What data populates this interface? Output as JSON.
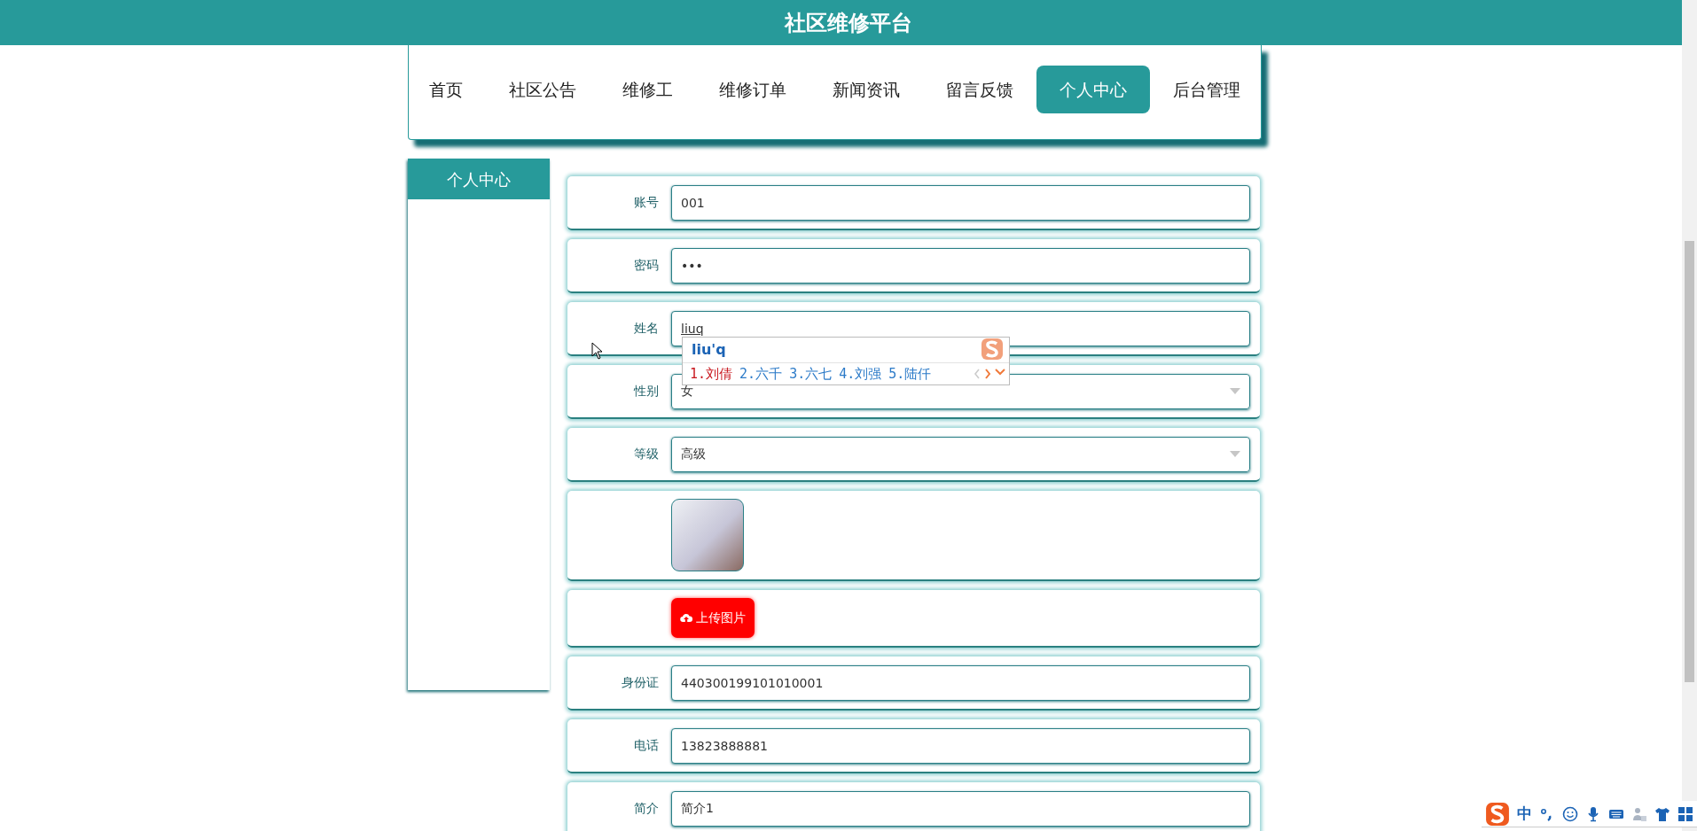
{
  "header": {
    "title": "社区维修平台"
  },
  "nav": [
    {
      "label": "首页",
      "selected": false
    },
    {
      "label": "社区公告",
      "selected": false
    },
    {
      "label": "维修工",
      "selected": false
    },
    {
      "label": "维修订单",
      "selected": false
    },
    {
      "label": "新闻资讯",
      "selected": false
    },
    {
      "label": "留言反馈",
      "selected": false
    },
    {
      "label": "个人中心",
      "selected": true
    },
    {
      "label": "后台管理",
      "selected": false
    }
  ],
  "sidebar": {
    "title": "个人中心"
  },
  "form": {
    "fields": [
      {
        "kind": "text",
        "label": "账号",
        "value": "001"
      },
      {
        "kind": "password",
        "label": "密码",
        "value": "•••"
      },
      {
        "kind": "text",
        "label": "姓名",
        "value": "liuq"
      },
      {
        "kind": "select",
        "label": "性别",
        "value": "女"
      },
      {
        "kind": "select",
        "label": "等级",
        "value": "高级"
      },
      {
        "kind": "photo"
      },
      {
        "kind": "upload",
        "button": "上传图片"
      },
      {
        "kind": "text",
        "label": "身份证",
        "value": "440300199101010001"
      },
      {
        "kind": "text",
        "label": "电话",
        "value": "13823888881"
      },
      {
        "kind": "text",
        "label": "简介",
        "value": "简介1"
      }
    ]
  },
  "ime_popup": {
    "composition": "liu'q",
    "candidates": [
      {
        "label": "1.刘倩",
        "selected": true
      },
      {
        "label": "2.六千",
        "selected": false
      },
      {
        "label": "3.六七",
        "selected": false
      },
      {
        "label": "4.刘强",
        "selected": false
      },
      {
        "label": "5.陆仟",
        "selected": false
      }
    ]
  },
  "ime_toolbar": {
    "mode": "中"
  }
}
